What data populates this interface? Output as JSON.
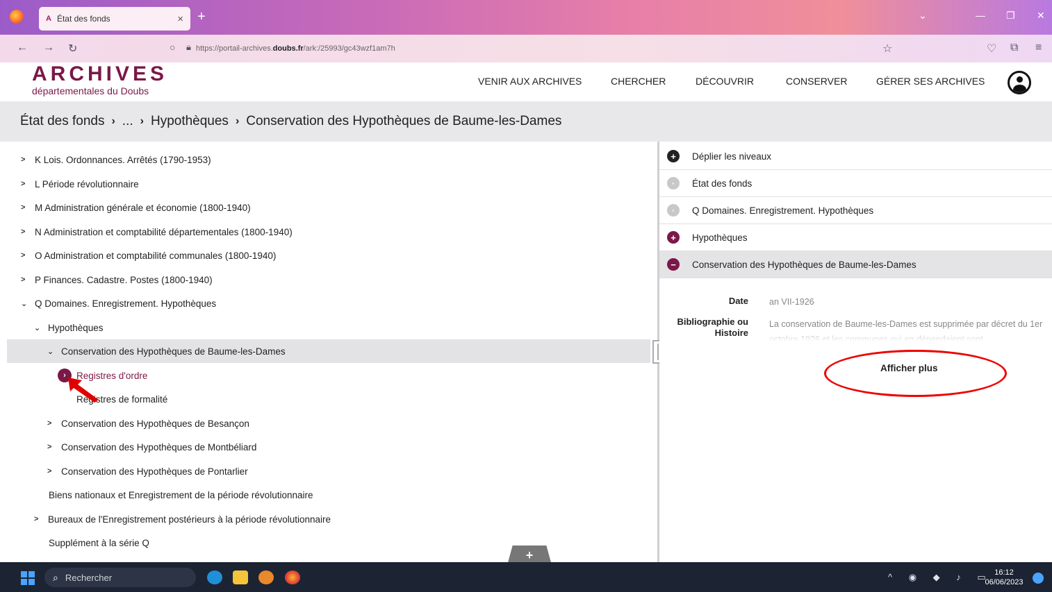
{
  "browser": {
    "tab_title": "État des fonds",
    "tab_favicon": "A",
    "url_prefix": "https://portail-archives.",
    "url_domain": "doubs.fr",
    "url_suffix": "/ark:/25993/gc43wzf1am7h",
    "colors": {
      "accent": "#7a1848",
      "gradient_start": "#9b5cc9",
      "gradient_end": "#f08f9a"
    }
  },
  "site": {
    "logo_title": "ARCHIVES",
    "logo_subtitle": "départementales du Doubs",
    "menu": [
      "VENIR AUX ARCHIVES",
      "CHERCHER",
      "DÉCOUVRIR",
      "CONSERVER",
      "GÉRER SES ARCHIVES"
    ]
  },
  "breadcrumb": [
    "État des fonds",
    "...",
    "Hypothèques",
    "Conservation des Hypothèques de Baume-les-Dames"
  ],
  "tree": [
    {
      "label": "K Lois. Ordonnances. Arrêtés (1790-1953)",
      "chevron": "right"
    },
    {
      "label": "L Période révolutionnaire",
      "chevron": "right"
    },
    {
      "label": "M Administration générale et économie (1800-1940)",
      "chevron": "right"
    },
    {
      "label": "N Administration et comptabilité départementales (1800-1940)",
      "chevron": "right"
    },
    {
      "label": "O Administration et comptabilité communales (1800-1940)",
      "chevron": "right"
    },
    {
      "label": "P Finances. Cadastre. Postes (1800-1940)",
      "chevron": "right"
    },
    {
      "label": "Q Domaines. Enregistrement. Hypothèques",
      "chevron": "down"
    },
    {
      "label": "Hypothèques",
      "chevron": "down"
    },
    {
      "label": "Conservation des Hypothèques de Baume-les-Dames",
      "chevron": "down"
    },
    {
      "label": "Registres d'ordre",
      "chevron": "circle"
    },
    {
      "label": "Registres de formalité",
      "chevron": "none"
    },
    {
      "label": "Conservation des Hypothèques de Besançon",
      "chevron": "right"
    },
    {
      "label": "Conservation des Hypothèques de Montbéliard",
      "chevron": "right"
    },
    {
      "label": "Conservation des Hypothèques de Pontarlier",
      "chevron": "right"
    },
    {
      "label": "Biens nationaux et Enregistrement de la période révolutionnaire",
      "chevron": "none"
    },
    {
      "label": "Bureaux de l'Enregistrement postérieurs à la période révolutionnaire",
      "chevron": "right"
    },
    {
      "label": "Supplément à la série Q",
      "chevron": "none"
    }
  ],
  "right_panel": {
    "rows": [
      {
        "label": "Déplier les niveaux",
        "icon": "plus",
        "color": "#222222"
      },
      {
        "label": "État des fonds",
        "icon": "dot",
        "color": "#c8c8c8"
      },
      {
        "label": "Q Domaines. Enregistrement. Hypothèques",
        "icon": "dot",
        "color": "#c8c8c8"
      },
      {
        "label": "Hypothèques",
        "icon": "plus",
        "color": "#7a1848"
      },
      {
        "label": "Conservation des Hypothèques de Baume-les-Dames",
        "icon": "minus",
        "color": "#7a1848"
      }
    ],
    "date_label": "Date",
    "date_value": "an VII-1926",
    "biblio_label_1": "Bibliographie ou",
    "biblio_label_2": "Histoire",
    "biblio_value": "La conservation de Baume-les-Dames est supprimée par décret du 1er octobre 1926 et les communes qui en dépendaient sont",
    "show_more": "Afficher plus"
  },
  "taskbar": {
    "search_placeholder": "Rechercher",
    "time": "16:12",
    "date": "06/06/2023"
  }
}
